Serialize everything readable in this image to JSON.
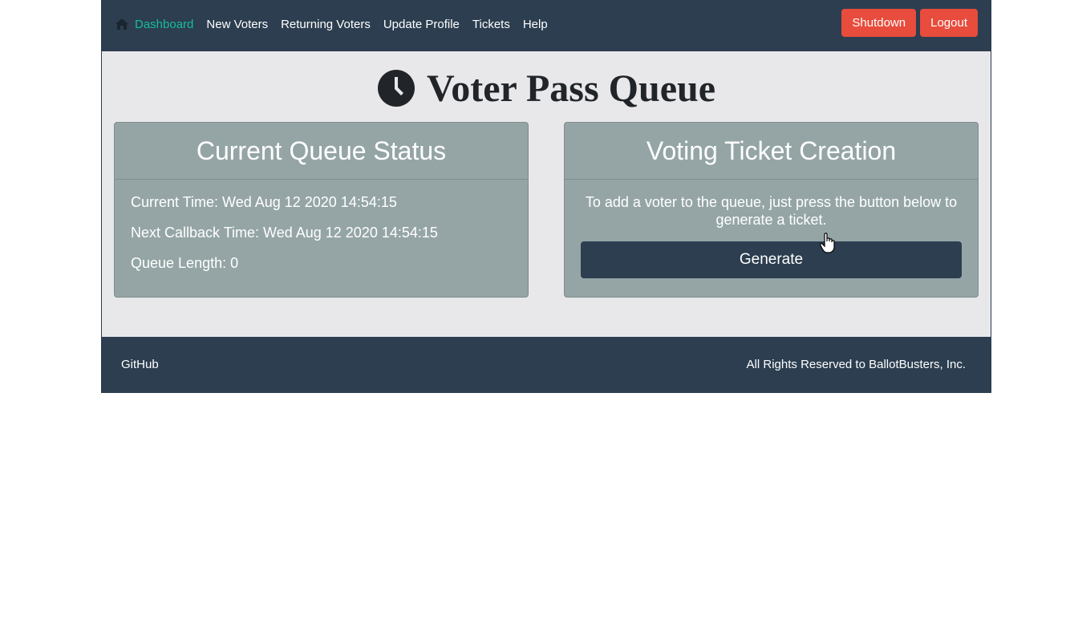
{
  "navbar": {
    "items": [
      {
        "label": "Dashboard",
        "icon": "home-icon",
        "active": true
      },
      {
        "label": "New Voters"
      },
      {
        "label": "Returning Voters"
      },
      {
        "label": "Update Profile"
      },
      {
        "label": "Tickets"
      },
      {
        "label": "Help"
      }
    ],
    "shutdown_label": "Shutdown",
    "logout_label": "Logout"
  },
  "page": {
    "title": "Voter Pass Queue",
    "title_icon": "clock-icon"
  },
  "queue_status": {
    "header": "Current Queue Status",
    "current_time": "Current Time: Wed Aug 12 2020 14:54:15",
    "next_callback": "Next Callback Time: Wed Aug 12 2020 14:54:15",
    "queue_length": "Queue Length: 0"
  },
  "ticket_creation": {
    "header": "Voting Ticket Creation",
    "instructions": "To add a voter to the queue, just press the button below to generate a ticket.",
    "button_label": "Generate"
  },
  "footer": {
    "link": "GitHub",
    "copyright": "All Rights Reserved to BallotBusters, Inc."
  },
  "colors": {
    "navbar": "#2c3e50",
    "active_link": "#18bc9c",
    "danger": "#e74c3c",
    "card": "#95a5a6",
    "page_bg": "#e8e8ea"
  }
}
